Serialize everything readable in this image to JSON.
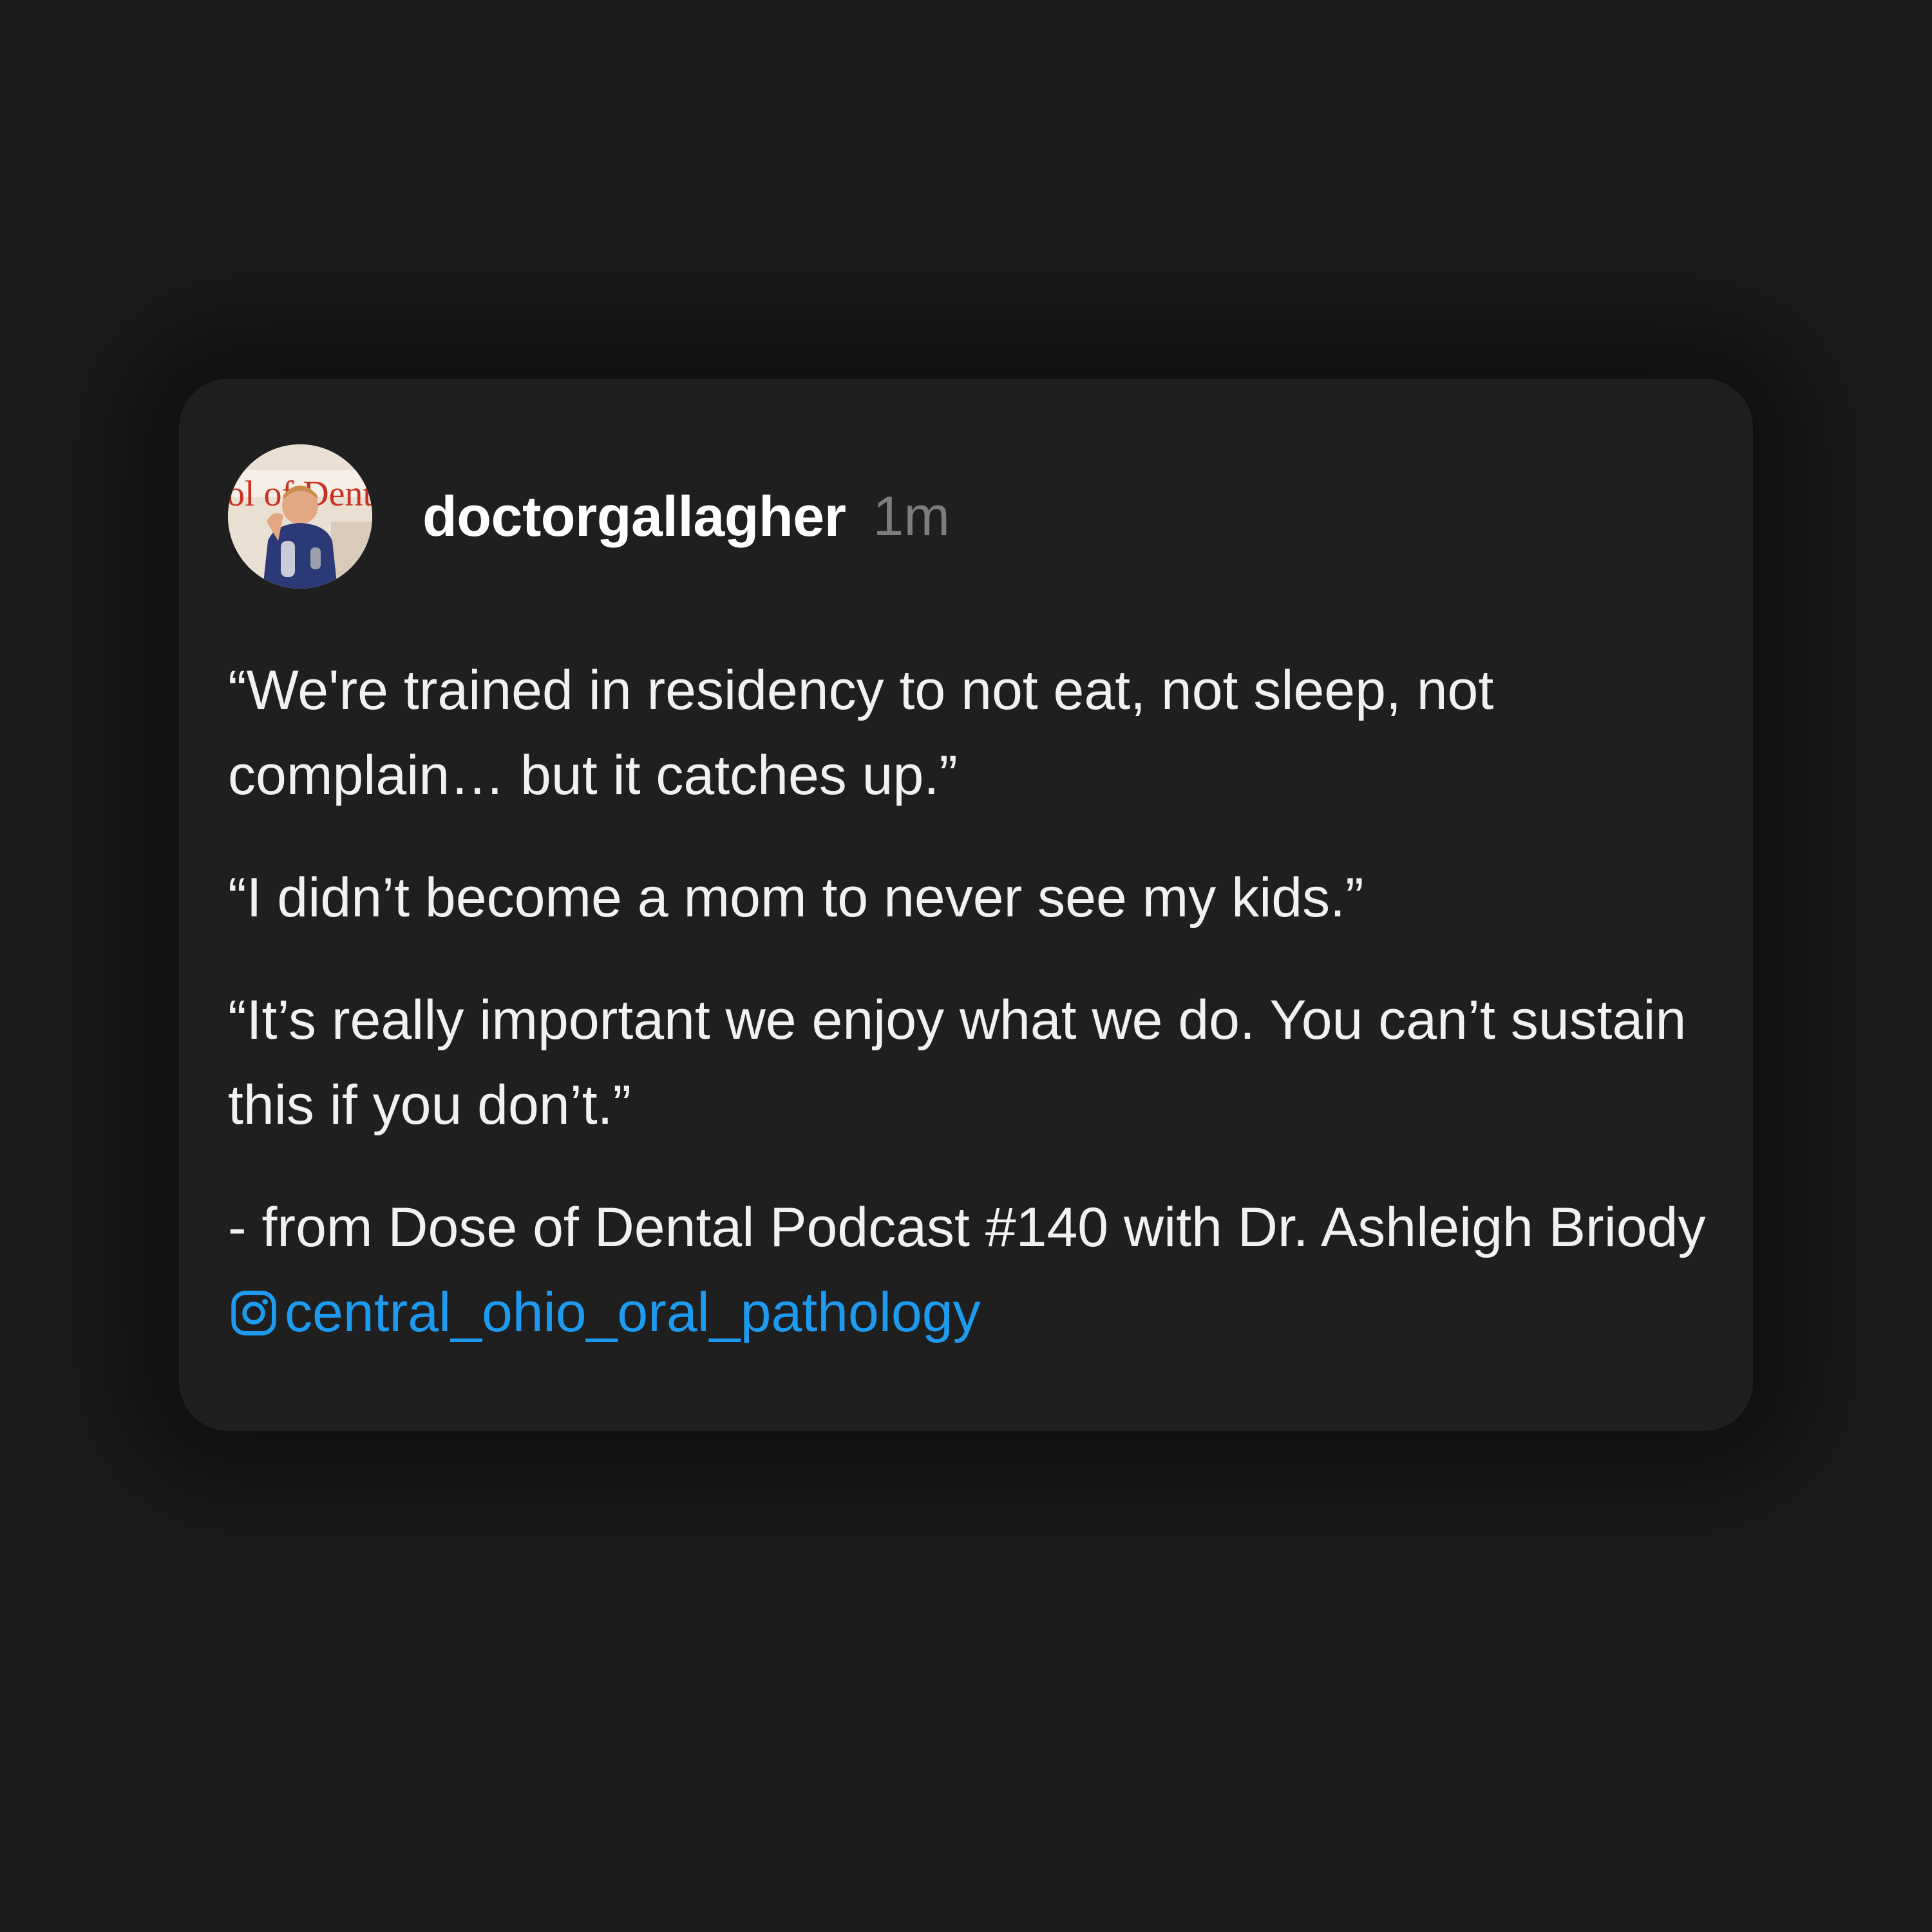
{
  "post": {
    "username": "doctorgallagher",
    "time": "1m",
    "avatar": {
      "icon": "user-avatar-photo",
      "visible_text": "ol of Dental"
    },
    "paragraphs": [
      "“We're trained in residency to not eat, not sleep, not complain… but it catches up.”",
      "“I didn’t become a mom to never see my kids.”",
      "“It’s really important we enjoy what we do. You can’t sustain this if you don’t.”"
    ],
    "credit_prefix": "- from Dose of Dental Podcast #140 with Dr. Ashleigh Briody ",
    "mention": {
      "icon": "instagram-icon",
      "handle": "central_ohio_oral_pathology"
    }
  },
  "colors": {
    "page_bg": "#1b1b1b",
    "card_bg": "#1f1f1f",
    "text": "#f1f1f1",
    "time": "#7d7d7d",
    "link": "#1d9bf0"
  }
}
